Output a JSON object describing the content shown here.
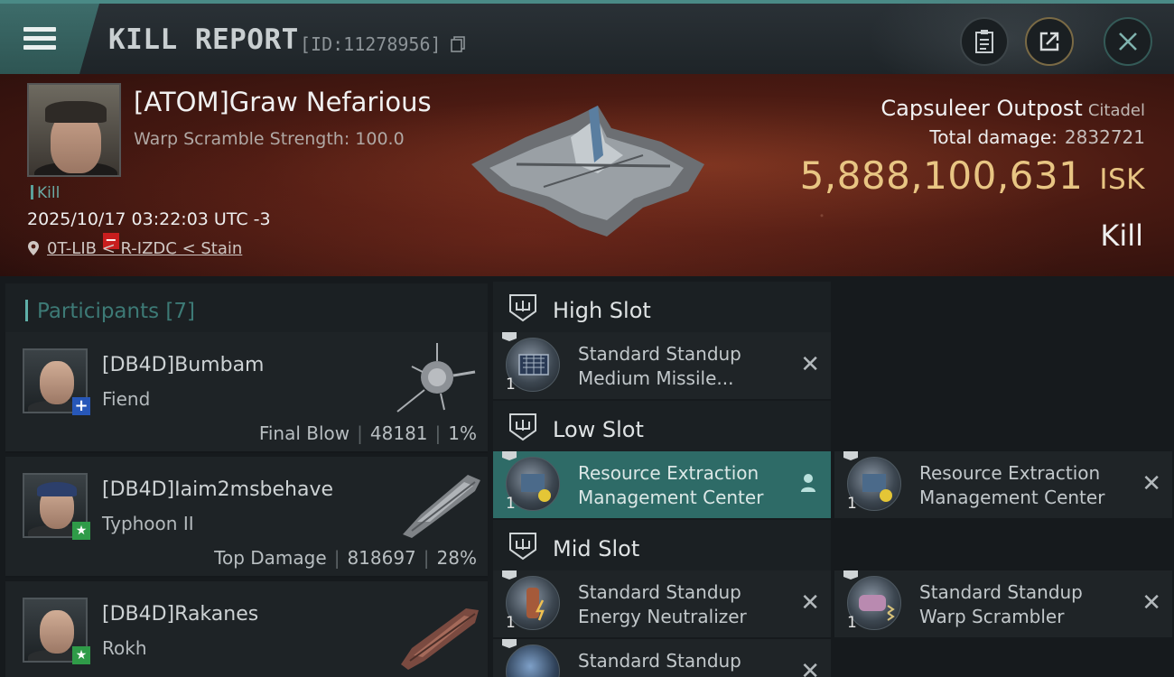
{
  "header": {
    "title": "KILL REPORT",
    "report_id": "[ID:11278956]"
  },
  "victim": {
    "name": "[ATOM]Graw Nefarious",
    "subtitle": "Warp Scramble Strength: 100.0",
    "kill_tag": "Kill",
    "datetime": "2025/10/17 03:22:03 UTC -3",
    "location": "0T-LIB < R-IZDC < Stain"
  },
  "target": {
    "name": "Capsuleer Outpost",
    "class": "Citadel",
    "total_damage_label": "Total damage:",
    "total_damage_value": "2832721",
    "isk_value": "5,888,100,631",
    "isk_unit": "ISK",
    "result": "Kill"
  },
  "participants": {
    "title": "Participants",
    "count": "[7]",
    "rows": [
      {
        "name": "[DB4D]Bumbam",
        "ship": "Fiend",
        "stat_label": "Final Blow",
        "damage": "48181",
        "percent": "1%",
        "badge": "+"
      },
      {
        "name": "[DB4D]Iaim2msbehave",
        "ship": "Typhoon II",
        "stat_label": "Top Damage",
        "damage": "818697",
        "percent": "28%",
        "badge": "★"
      },
      {
        "name": "[DB4D]Rakanes",
        "ship": "Rokh",
        "stat_label": "",
        "damage": "",
        "percent": "",
        "badge": "★"
      }
    ]
  },
  "fittings": {
    "high_slot": {
      "title": "High Slot",
      "items": [
        {
          "name_line1": "Standard Standup",
          "name_line2": "Medium Missile...",
          "qty": "1"
        }
      ]
    },
    "low_slot": {
      "title": "Low Slot",
      "items": [
        {
          "name_line1": "Resource Extraction",
          "name_line2": "Management Center",
          "qty": "1"
        },
        {
          "name_line1": "Resource Extraction",
          "name_line2": "Management Center",
          "qty": "1"
        }
      ]
    },
    "mid_slot": {
      "title": "Mid Slot",
      "items": [
        {
          "name_line1": "Standard Standup",
          "name_line2": "Energy Neutralizer",
          "qty": "1"
        },
        {
          "name_line1": "Standard Standup",
          "name_line2": "Warp Scrambler",
          "qty": "1"
        },
        {
          "name_line1": "Standard Standup",
          "name_line2": "",
          "qty": ""
        }
      ]
    }
  },
  "colors": {
    "accent_teal": "#3d6c6a",
    "isk_gold": "#e8c583",
    "highlight_row": "#2e6b67"
  }
}
